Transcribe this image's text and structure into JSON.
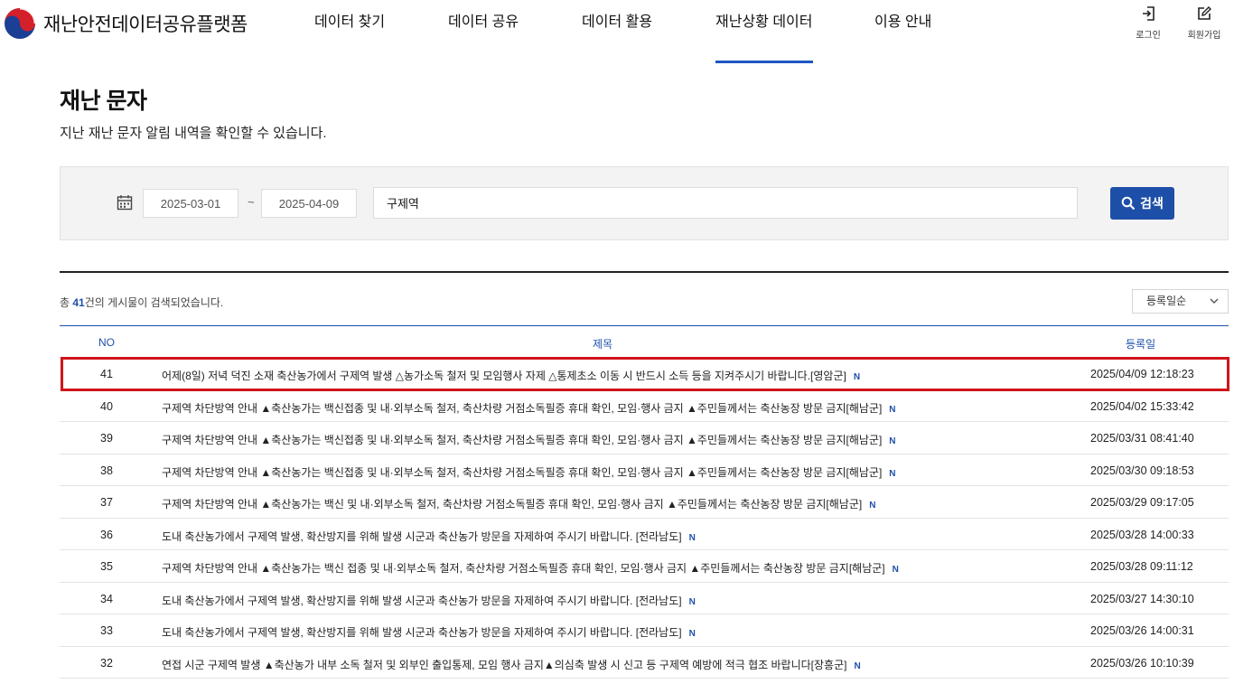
{
  "header": {
    "logo_text": "재난안전데이터공유플랫폼",
    "nav": [
      {
        "label": "데이터 찾기"
      },
      {
        "label": "데이터 공유"
      },
      {
        "label": "데이터 활용"
      },
      {
        "label": "재난상황 데이터",
        "active": true
      },
      {
        "label": "이용 안내"
      }
    ],
    "login_label": "로그인",
    "signup_label": "회원가입"
  },
  "page": {
    "title": "재난 문자",
    "description": "지난 재난 문자 알림 내역을 확인할 수 있습니다."
  },
  "search": {
    "start_date": "2025-03-01",
    "tilde": "~",
    "end_date": "2025-04-09",
    "keyword": "구제역",
    "button_label": "검색"
  },
  "results": {
    "prefix": "총 ",
    "count": "41",
    "suffix": "건의 게시물이 검색되었습니다.",
    "sort_label": "등록일순"
  },
  "table": {
    "headers": {
      "no": "NO",
      "title": "제목",
      "date": "등록일"
    },
    "new_badge": "N",
    "rows": [
      {
        "no": "41",
        "title": "어제(8일) 저녁 덕진 소재 축산농가에서 구제역 발생 △농가소독 철저 및 모임행사 자제 △통제초소 이동 시 반드시 소득 등을 지켜주시기 바랍니다.[영암군]",
        "date": "2025/04/09 12:18:23"
      },
      {
        "no": "40",
        "title": "구제역 차단방역 안내 ▲축산농가는 백신접종 및 내·외부소독 철저, 축산차량 거점소독필증 휴대 확인, 모임·행사 금지 ▲주민들께서는 축산농장 방문 금지[해남군]",
        "date": "2025/04/02 15:33:42"
      },
      {
        "no": "39",
        "title": "구제역 차단방역 안내 ▲축산농가는 백신접종 및 내·외부소독 철저, 축산차량 거점소독필증 휴대 확인, 모임·행사 금지 ▲주민들께서는 축산농장 방문 금지[해남군]",
        "date": "2025/03/31 08:41:40"
      },
      {
        "no": "38",
        "title": "구제역 차단방역 안내 ▲축산농가는 백신접종 및 내·외부소독 철저, 축산차량 거점소독필증 휴대 확인, 모임·행사 금지 ▲주민들께서는 축산농장 방문 금지[해남군]",
        "date": "2025/03/30 09:18:53"
      },
      {
        "no": "37",
        "title": "구제역 차단방역 안내 ▲축산농가는 백신 및 내·외부소독 철저, 축산차량 거점소독필증 휴대 확인, 모임·행사 금지 ▲주민들께서는 축산농장 방문 금지[해남군]",
        "date": "2025/03/29 09:17:05"
      },
      {
        "no": "36",
        "title": "도내 축산농가에서 구제역 발생, 확산방지를 위해 발생 시군과 축산농가 방문을 자제하여 주시기 바랍니다. [전라남도]",
        "date": "2025/03/28 14:00:33"
      },
      {
        "no": "35",
        "title": "구제역 차단방역 안내 ▲축산농가는 백신 접종 및 내·외부소독 철저, 축산차량 거점소독필증 휴대 확인, 모임·행사 금지 ▲주민들께서는 축산농장 방문 금지[해남군]",
        "date": "2025/03/28 09:11:12"
      },
      {
        "no": "34",
        "title": "도내 축산농가에서 구제역 발생, 확산방지를 위해 발생 시군과 축산농가 방문을 자제하여 주시기 바랍니다. [전라남도]",
        "date": "2025/03/27 14:30:10"
      },
      {
        "no": "33",
        "title": "도내 축산농가에서 구제역 발생, 확산방지를 위해 발생 시군과 축산농가 방문을 자제하여 주시기 바랍니다. [전라남도]",
        "date": "2025/03/26 14:00:31"
      },
      {
        "no": "32",
        "title": "연접 시군 구제역 발생 ▲축산농가 내부 소독 철저 및 외부인 출입통제, 모임 행사 금지▲의심축 발생 시 신고 등 구제역 예방에 적극 협조 바랍니다[장흥군]",
        "date": "2025/03/26 10:10:39"
      }
    ]
  }
}
